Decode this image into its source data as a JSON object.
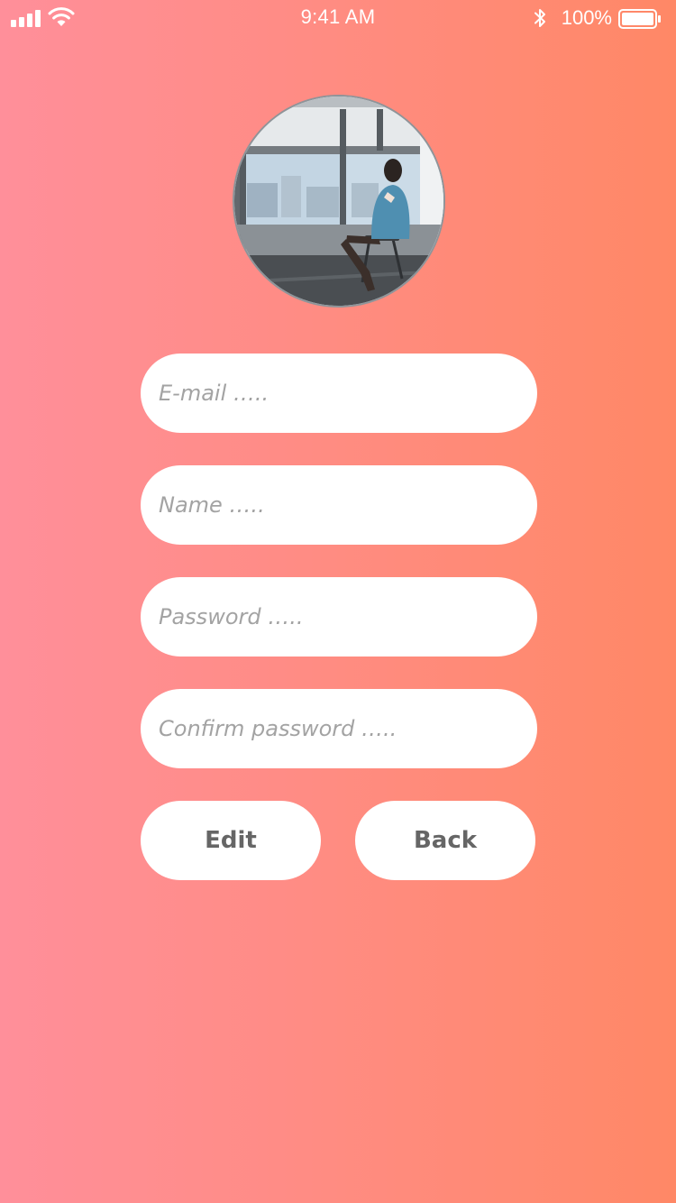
{
  "status_bar": {
    "time": "9:41 AM",
    "battery_percent": "100%",
    "battery_level": 1.0,
    "signal_icon": "cellular-signal-icon",
    "wifi_icon": "wifi-icon",
    "bluetooth_icon": "bluetooth-icon",
    "battery_icon": "battery-icon"
  },
  "profile": {
    "avatar": "profile-photo"
  },
  "form": {
    "email": {
      "value": "",
      "placeholder": "E-mail ….."
    },
    "name": {
      "value": "",
      "placeholder": "Name ….."
    },
    "password": {
      "value": "",
      "placeholder": "Password ….."
    },
    "confirm_password": {
      "value": "",
      "placeholder": "Confirm password ….."
    }
  },
  "actions": {
    "edit_label": "Edit",
    "back_label": "Back"
  },
  "colors": {
    "background_start": "#ff8f9a",
    "background_end": "#ff8866",
    "field_background": "#ffffff",
    "button_text": "#666666",
    "placeholder_text": "#a3a3a3"
  }
}
